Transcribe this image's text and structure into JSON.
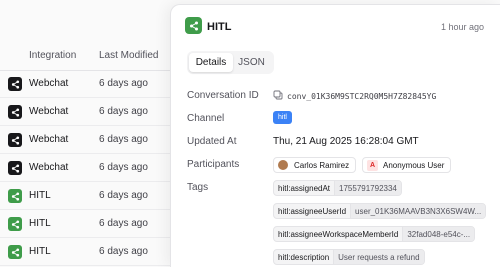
{
  "table": {
    "headers": {
      "integration": "Integration",
      "last_modified": "Last Modified"
    },
    "rows": [
      {
        "name": "Webchat",
        "modified": "6 days ago",
        "icon": "share-icon",
        "icon_color": "#18181b"
      },
      {
        "name": "Webchat",
        "modified": "6 days ago",
        "icon": "share-icon",
        "icon_color": "#18181b"
      },
      {
        "name": "Webchat",
        "modified": "6 days ago",
        "icon": "share-icon",
        "icon_color": "#18181b"
      },
      {
        "name": "Webchat",
        "modified": "6 days ago",
        "icon": "share-icon",
        "icon_color": "#18181b"
      },
      {
        "name": "HITL",
        "modified": "6 days ago",
        "icon": "share-icon",
        "icon_color": "#3f9c4a"
      },
      {
        "name": "HITL",
        "modified": "6 days ago",
        "icon": "share-icon",
        "icon_color": "#3f9c4a"
      },
      {
        "name": "HITL",
        "modified": "6 days ago",
        "icon": "share-icon",
        "icon_color": "#3f9c4a"
      }
    ]
  },
  "panel": {
    "title": "HITL",
    "time": "1 hour ago",
    "accent": "#3f9c4a",
    "tabs": {
      "details": "Details",
      "json": "JSON"
    },
    "fields": {
      "conversation_id_label": "Conversation ID",
      "conversation_id": "conv_01K36M9STC2RQ0M5H7Z82845YG",
      "channel_label": "Channel",
      "channel": "hitl",
      "updated_at_label": "Updated At",
      "updated_at": "Thu, 21 Aug 2025 16:28:04 GMT",
      "participants_label": "Participants",
      "participants": [
        "Carlos Ramirez",
        "Anonymous User"
      ],
      "anonymous_badge": "A",
      "tags_label": "Tags"
    },
    "tags": [
      {
        "key": "hitl:assignedAt",
        "value": "1755791792334"
      },
      {
        "key": "hitl:assigneeUserId",
        "value": "user_01K36MAAVB3N3X6SW4W..."
      },
      {
        "key": "hitl:assigneeWorkspaceMemberId",
        "value": "32fad048-e54c-..."
      },
      {
        "key": "hitl:description",
        "value": "User requests a refund"
      }
    ]
  }
}
